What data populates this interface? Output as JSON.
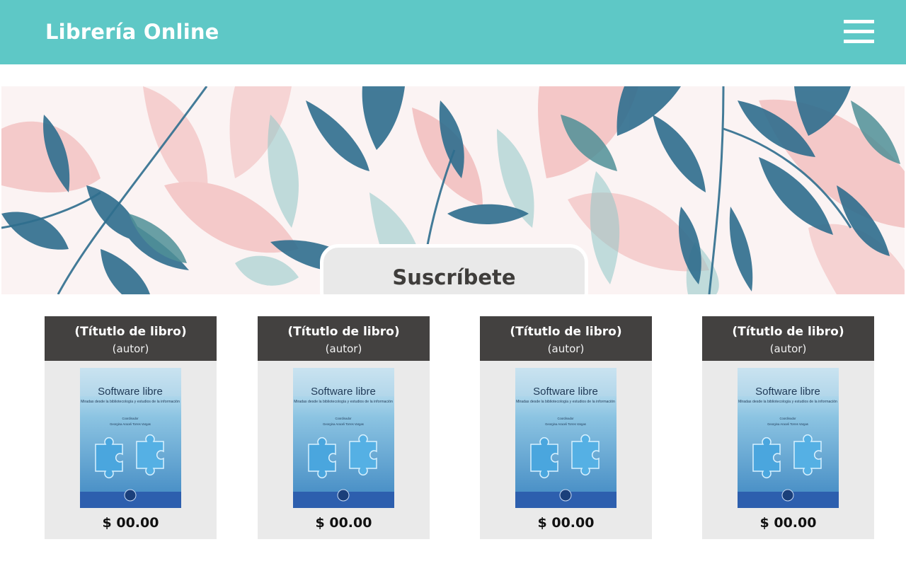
{
  "header": {
    "brand": "Librería Online",
    "menu_icon": "hamburger-menu-icon",
    "bg_color": "#5ec8c6"
  },
  "hero": {
    "subscribe_label": "Suscríbete",
    "image": "watercolor-leaves-banner"
  },
  "products": [
    {
      "title": "(Títutlo de libro)",
      "author": "(autor)",
      "price": "$ 00.00",
      "cover": {
        "title": "Software libre",
        "subtitle": "Miradas desde la bibliotecología y estudios de la información",
        "coordinator_label": "Coordinador",
        "coordinator_name": "Georgina Araceli Torres Vargas"
      }
    },
    {
      "title": "(Títutlo de libro)",
      "author": "(autor)",
      "price": "$ 00.00",
      "cover": {
        "title": "Software libre",
        "subtitle": "Miradas desde la bibliotecología y estudios de la información",
        "coordinator_label": "Coordinador",
        "coordinator_name": "Georgina Araceli Torres Vargas"
      }
    },
    {
      "title": "(Títutlo de libro)",
      "author": "(autor)",
      "price": "$ 00.00",
      "cover": {
        "title": "Software libre",
        "subtitle": "Miradas desde la bibliotecología y estudios de la información",
        "coordinator_label": "Coordinador",
        "coordinator_name": "Georgina Araceli Torres Vargas"
      }
    },
    {
      "title": "(Títutlo de libro)",
      "author": "(autor)",
      "price": "$ 00.00",
      "cover": {
        "title": "Software libre",
        "subtitle": "Miradas desde la bibliotecología y estudios de la información",
        "coordinator_label": "Coordinador",
        "coordinator_name": "Georgina Araceli Torres Vargas"
      }
    }
  ],
  "colors": {
    "card_header": "#434140",
    "card_body": "#eaeaea",
    "button_bg": "#e9e9e9",
    "leaf_blue": "#2f6e8e",
    "leaf_pink": "#f1b9b9"
  }
}
